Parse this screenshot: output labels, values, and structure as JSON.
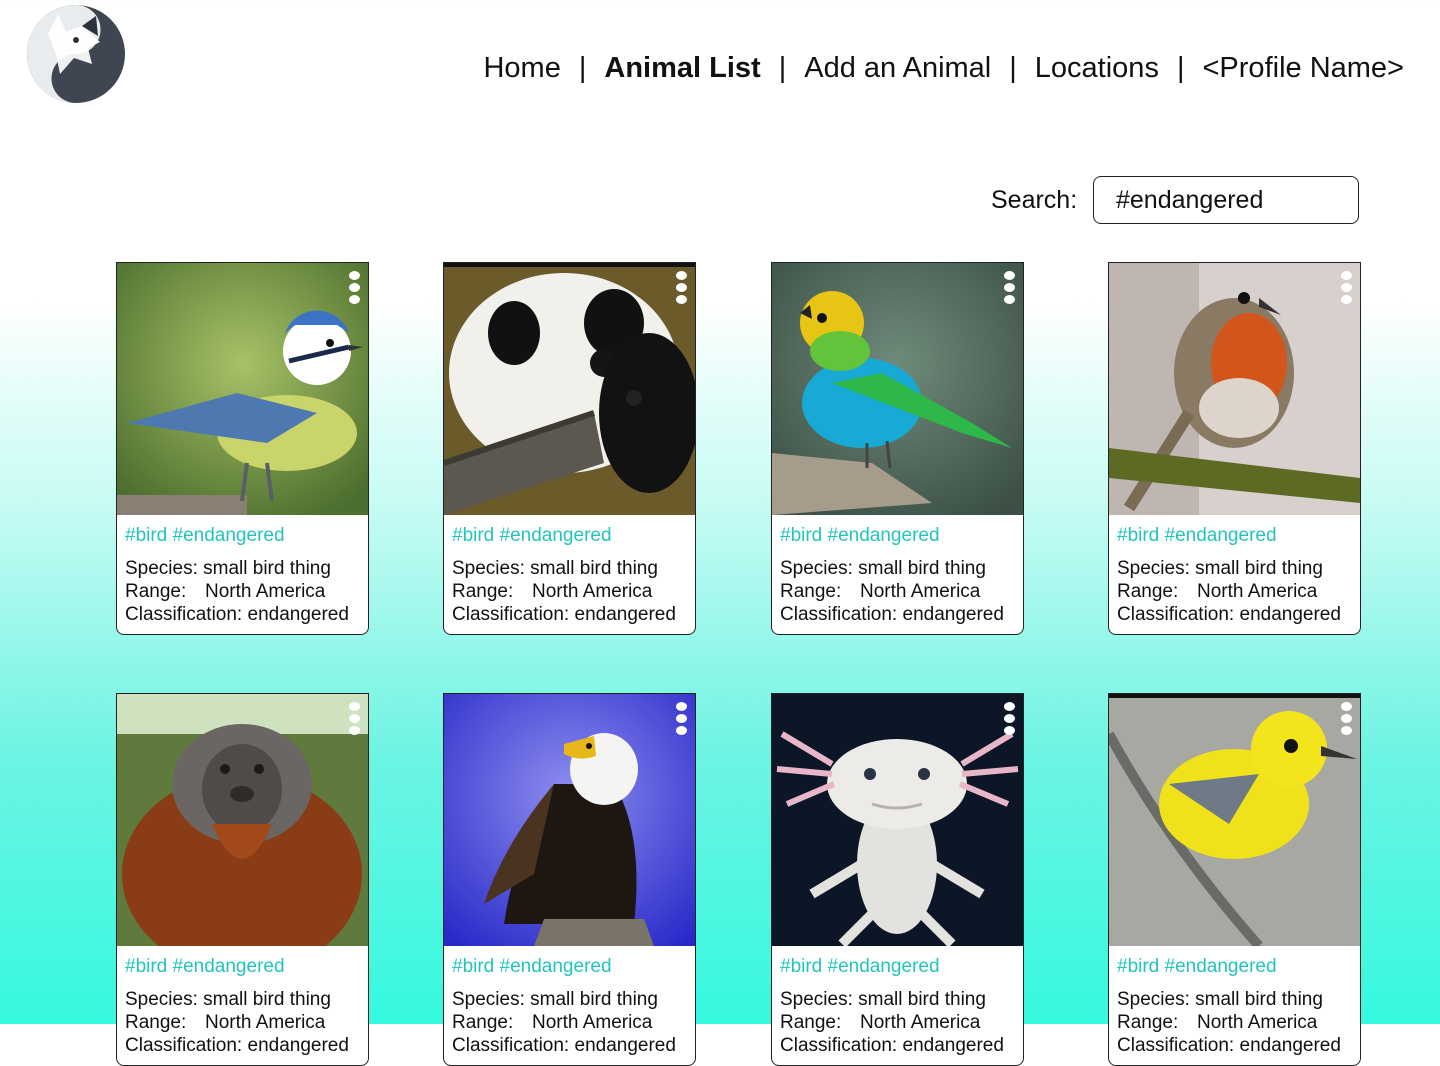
{
  "nav": {
    "home": "Home",
    "animal_list": "Animal List",
    "add_animal": "Add an Animal",
    "locations": "Locations",
    "profile": "<Profile Name>",
    "separator": "|"
  },
  "search": {
    "label": "Search:",
    "value": "#endangered"
  },
  "colors": {
    "tag": "#22c4be",
    "gradient_bottom": "#35f9e0"
  },
  "cards": [
    {
      "tags": "#bird #endangered",
      "species_label": "Species:",
      "species": "small bird thing",
      "range_label": "Range:",
      "range": "North America",
      "class_label": "Classification:",
      "classification": "endangered",
      "image": "blue-tit-photo"
    },
    {
      "tags": "#bird #endangered",
      "species_label": "Species:",
      "species": "small bird thing",
      "range_label": "Range:",
      "range": "North America",
      "class_label": "Classification:",
      "classification": "endangered",
      "image": "panda-photo"
    },
    {
      "tags": "#bird #endangered",
      "species_label": "Species:",
      "species": "small bird thing",
      "range_label": "Range:",
      "range": "North America",
      "class_label": "Classification:",
      "classification": "endangered",
      "image": "tanager-photo"
    },
    {
      "tags": "#bird #endangered",
      "species_label": "Species:",
      "species": "small bird thing",
      "range_label": "Range:",
      "range": "North America",
      "class_label": "Classification:",
      "classification": "endangered",
      "image": "robin-photo"
    },
    {
      "tags": "#bird #endangered",
      "species_label": "Species:",
      "species": "small bird thing",
      "range_label": "Range:",
      "range": "North America",
      "class_label": "Classification:",
      "classification": "endangered",
      "image": "orangutan-photo"
    },
    {
      "tags": "#bird #endangered",
      "species_label": "Species:",
      "species": "small bird thing",
      "range_label": "Range:",
      "range": "North America",
      "class_label": "Classification:",
      "classification": "endangered",
      "image": "bald-eagle-photo"
    },
    {
      "tags": "#bird #endangered",
      "species_label": "Species:",
      "species": "small bird thing",
      "range_label": "Range:",
      "range": "North America",
      "class_label": "Classification:",
      "classification": "endangered",
      "image": "axolotl-photo"
    },
    {
      "tags": "#bird #endangered",
      "species_label": "Species:",
      "species": "small bird thing",
      "range_label": "Range:",
      "range": "North America",
      "class_label": "Classification:",
      "classification": "endangered",
      "image": "warbler-photo"
    }
  ]
}
